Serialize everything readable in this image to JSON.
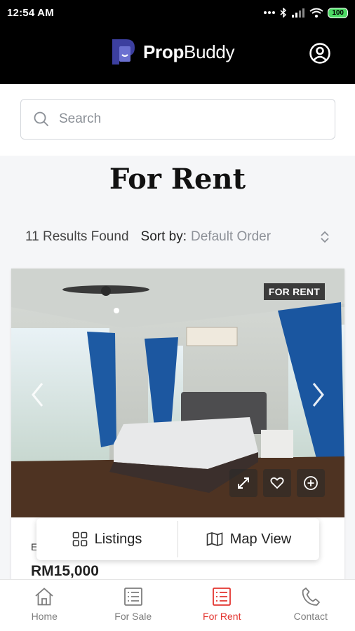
{
  "status_bar": {
    "time": "12:54 AM",
    "battery": "100"
  },
  "header": {
    "brand_bold": "Prop",
    "brand_light": "Buddy"
  },
  "search": {
    "placeholder": "Search"
  },
  "page": {
    "title": "For Rent"
  },
  "results": {
    "count_text": "11 Results Found",
    "sort_label": "Sort by:",
    "sort_value": "Default Order"
  },
  "listing": {
    "tag": "FOR RENT",
    "title_fragment": "E",
    "price": "RM15,000"
  },
  "view_toggle": {
    "listings_label": "Listings",
    "map_label": "Map View"
  },
  "bottom_nav": {
    "items": [
      {
        "label": "Home",
        "icon": "home-icon"
      },
      {
        "label": "For Sale",
        "icon": "list-icon"
      },
      {
        "label": "For Rent",
        "icon": "list-icon",
        "active": true
      },
      {
        "label": "Contact",
        "icon": "phone-icon"
      }
    ]
  },
  "colors": {
    "accent": "#e3342f",
    "header_bg": "#000000",
    "brand_logo": "#3c3f9f"
  }
}
